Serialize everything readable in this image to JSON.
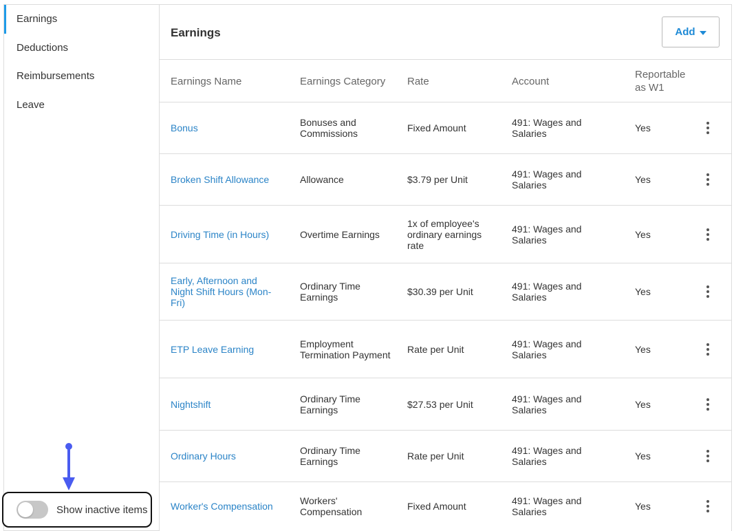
{
  "sidebar": {
    "items": [
      {
        "label": "Earnings",
        "active": true
      },
      {
        "label": "Deductions",
        "active": false
      },
      {
        "label": "Reimbursements",
        "active": false
      },
      {
        "label": "Leave",
        "active": false
      }
    ],
    "toggle": {
      "label": "Show inactive items",
      "on": false
    }
  },
  "main": {
    "title": "Earnings",
    "add_label": "Add",
    "columns": [
      "Earnings Name",
      "Earnings Category",
      "Rate",
      "Account",
      "Reportable as W1"
    ],
    "rows": [
      {
        "name": "Bonus",
        "category": "Bonuses and Commissions",
        "rate": "Fixed Amount",
        "account": "491: Wages and Salaries",
        "reportable": "Yes"
      },
      {
        "name": "Broken Shift Allowance",
        "category": "Allowance",
        "rate": "$3.79 per Unit",
        "account": "491: Wages and Salaries",
        "reportable": "Yes"
      },
      {
        "name": "Driving Time (in Hours)",
        "category": "Overtime Earnings",
        "rate": "1x of employee's ordinary earnings rate",
        "account": "491: Wages and Salaries",
        "reportable": "Yes"
      },
      {
        "name": "Early, Afternoon and Night Shift Hours (Mon-Fri)",
        "category": "Ordinary Time Earnings",
        "rate": "$30.39 per Unit",
        "account": "491: Wages and Salaries",
        "reportable": "Yes"
      },
      {
        "name": "ETP Leave Earning",
        "category": "Employment Termination Payment",
        "rate": "Rate per Unit",
        "account": "491: Wages and Salaries",
        "reportable": "Yes"
      },
      {
        "name": "Nightshift",
        "category": "Ordinary Time Earnings",
        "rate": "$27.53 per Unit",
        "account": "491: Wages and Salaries",
        "reportable": "Yes"
      },
      {
        "name": "Ordinary Hours",
        "category": "Ordinary Time Earnings",
        "rate": "Rate per Unit",
        "account": "491: Wages and Salaries",
        "reportable": "Yes"
      },
      {
        "name": "Worker's Compensation",
        "category": "Workers' Compensation",
        "rate": "Fixed Amount",
        "account": "491: Wages and Salaries",
        "reportable": "Yes"
      }
    ]
  },
  "icons": {
    "row_menu": "more-vertical-icon",
    "add_caret": "chevron-down-icon",
    "annotation": "arrow-down-annotation-icon"
  },
  "colors": {
    "link": "#2b84c7",
    "accent": "#1e9be8",
    "annotation": "#4a5cf0"
  }
}
